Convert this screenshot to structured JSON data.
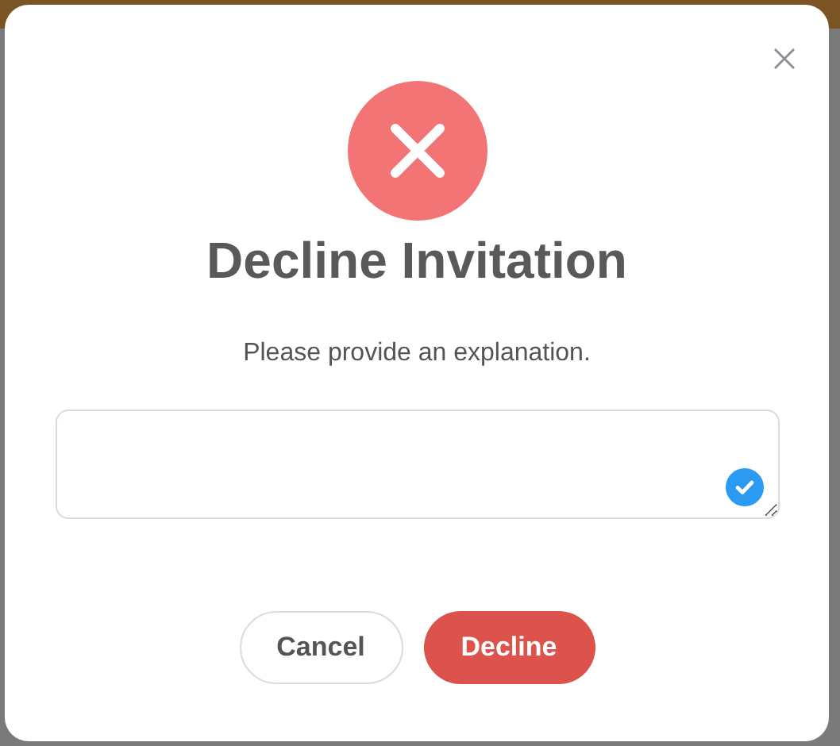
{
  "dialog": {
    "title": "Decline Invitation",
    "message": "Please provide an explanation.",
    "buttons": [
      {
        "label": "Cancel",
        "kind": "secondary"
      },
      {
        "label": "Decline",
        "kind": "danger"
      }
    ]
  }
}
